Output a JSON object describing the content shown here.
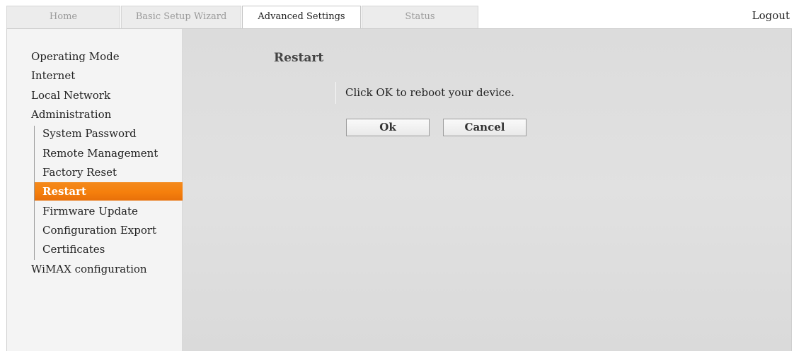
{
  "tabs": [
    {
      "label": "Home"
    },
    {
      "label": "Basic Setup Wizard"
    },
    {
      "label": "Advanced Settings"
    },
    {
      "label": "Status"
    }
  ],
  "active_tab": "Advanced Settings",
  "header": {
    "logout_label": "Logout"
  },
  "sidebar": {
    "items": [
      {
        "label": "Operating Mode"
      },
      {
        "label": "Internet"
      },
      {
        "label": "Local Network"
      },
      {
        "label": "Administration"
      },
      {
        "label": "WiMAX configuration"
      }
    ],
    "admin_subitems": [
      {
        "label": "System Password"
      },
      {
        "label": "Remote Management"
      },
      {
        "label": "Factory Reset"
      },
      {
        "label": "Restart"
      },
      {
        "label": "Firmware Update"
      },
      {
        "label": "Configuration Export"
      },
      {
        "label": "Certificates"
      }
    ],
    "selected": "Restart"
  },
  "main": {
    "title": "Restart",
    "message": "Click OK to reboot your device.",
    "ok_label": "Ok",
    "cancel_label": "Cancel"
  },
  "colors": {
    "accent": "#f57f0c",
    "content_bg": "#dddddd",
    "sidebar_bg": "#f4f4f4"
  }
}
